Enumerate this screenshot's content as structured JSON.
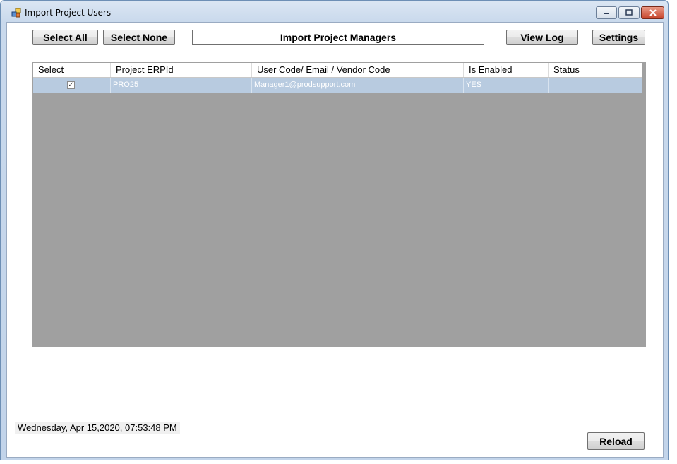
{
  "window": {
    "title": "Import Project Users"
  },
  "toolbar": {
    "select_all": "Select All",
    "select_none": "Select None",
    "import_managers": "Import Project Managers",
    "view_log": "View Log",
    "settings": "Settings"
  },
  "grid": {
    "columns": [
      "Select",
      "Project ERPId",
      "User Code/ Email / Vendor Code",
      "Is Enabled",
      "Status"
    ],
    "rows": [
      {
        "selected": true,
        "project_erp_id": "PRO25",
        "user_code": "Manager1@prodsupport.com",
        "is_enabled": "YES",
        "status": ""
      }
    ]
  },
  "footer": {
    "datetime": "Wednesday, Apr 15,2020, 07:53:48 PM",
    "reload": "Reload"
  },
  "colors": {
    "selection": "#b8cbe0",
    "grid_background": "#a0a0a0"
  }
}
